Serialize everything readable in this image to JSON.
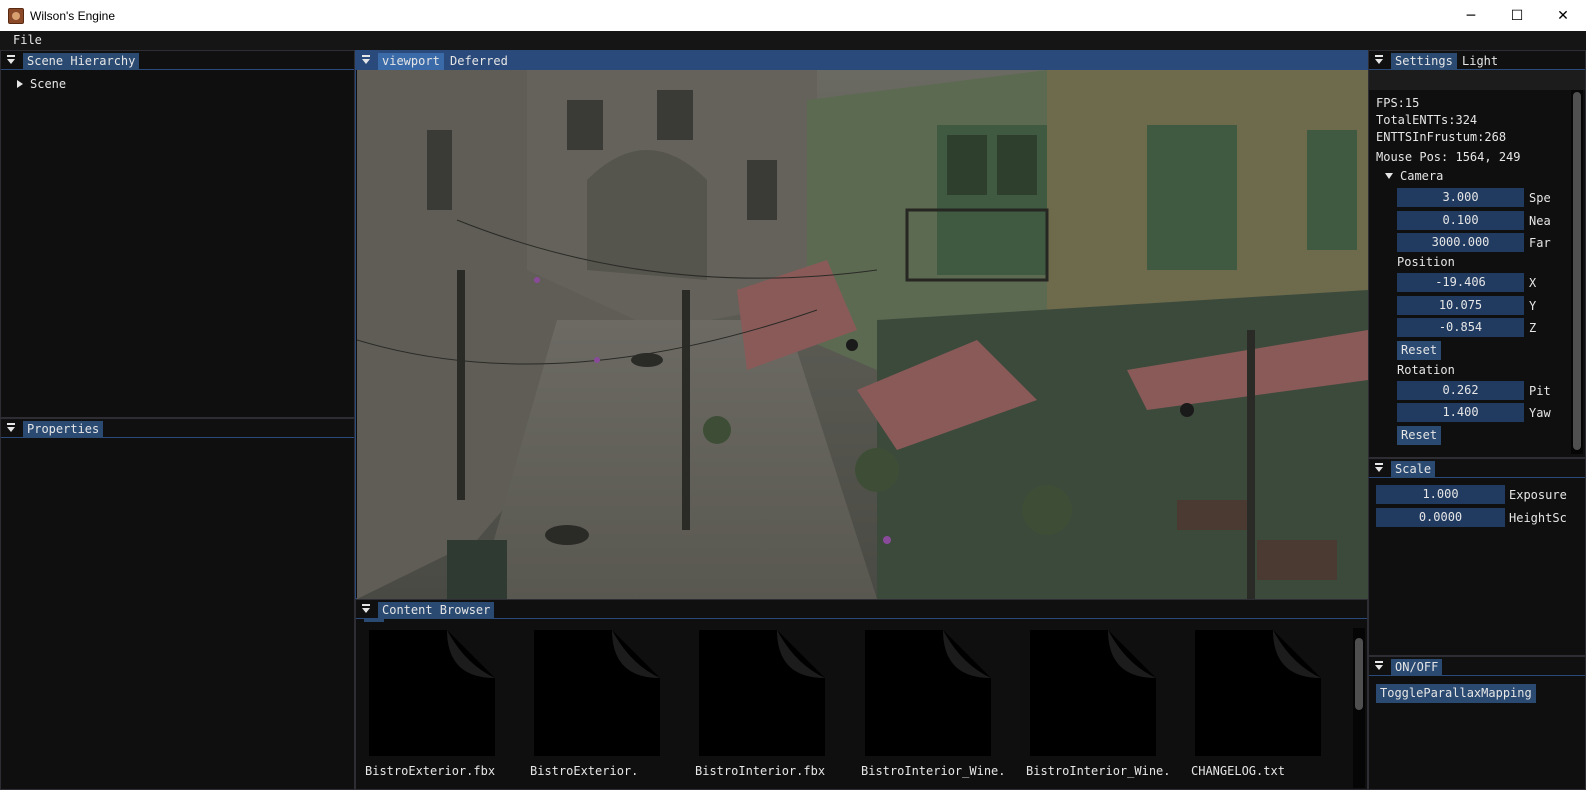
{
  "window": {
    "title": "Wilson's Engine",
    "minimize": "─",
    "maximize": "☐",
    "close": "✕"
  },
  "menu": {
    "items": [
      "File"
    ]
  },
  "scene_hierarchy": {
    "tab": "Scene Hierarchy",
    "root": "Scene"
  },
  "properties": {
    "tab": "Properties"
  },
  "viewport": {
    "tabs": [
      "viewport",
      "Deferred"
    ]
  },
  "content_browser": {
    "tab": "Content Browser",
    "files": [
      {
        "name": "BistroExterior.fbx"
      },
      {
        "name": "BistroExterior."
      },
      {
        "name": "BistroInterior.fbx"
      },
      {
        "name": "BistroInterior_Wine."
      },
      {
        "name": "BistroInterior_Wine."
      },
      {
        "name": "CHANGELOG.txt"
      }
    ]
  },
  "settings": {
    "tabs": [
      "Settings",
      "Light"
    ],
    "fps": "FPS:15",
    "total_entts": "TotalENTTs:324",
    "entts_in_frustum": "ENTTSInFrustum:268",
    "mouse_pos": "Mouse Pos: 1564, 249",
    "camera_label": "Camera",
    "speed": {
      "value": "3.000",
      "label": "Spe"
    },
    "near": {
      "value": "0.100",
      "label": "Nea"
    },
    "far": {
      "value": "3000.000",
      "label": "Far"
    },
    "position_label": "Position",
    "pos_x": {
      "value": "-19.406",
      "label": "X"
    },
    "pos_y": {
      "value": "10.075",
      "label": "Y"
    },
    "pos_z": {
      "value": "-0.854",
      "label": "Z"
    },
    "reset_label": "Reset",
    "rotation_label": "Rotation",
    "pitch": {
      "value": "0.262",
      "label": "Pit"
    },
    "yaw": {
      "value": "1.400",
      "label": "Yaw"
    }
  },
  "scale": {
    "tab": "Scale",
    "exposure": {
      "value": "1.000",
      "label": "Exposure"
    },
    "height_scale": {
      "value": "0.0000",
      "label": "HeightSc"
    }
  },
  "onoff": {
    "tab": "ON/OFF",
    "toggle_label": "ToggleParallaxMapping"
  },
  "colors": {
    "accent": "#294a7a",
    "tab": "#2a4a72",
    "text_green": "#40ff40",
    "bg": "#0f0f0f"
  }
}
